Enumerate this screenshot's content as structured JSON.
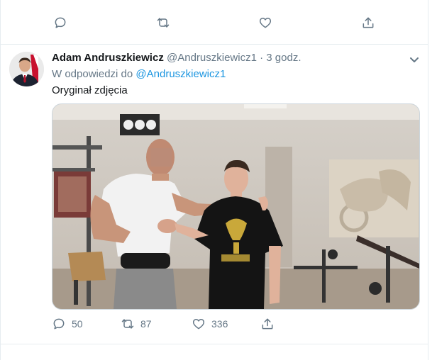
{
  "prev_actions": {
    "reply_icon": "reply-icon",
    "retweet_icon": "retweet-icon",
    "like_icon": "like-icon",
    "share_icon": "share-icon"
  },
  "tweet": {
    "author_name": "Adam Andruszkiewicz",
    "author_handle": "@Andruszkiewicz1",
    "separator": "·",
    "time": "3 godz.",
    "reply_prefix": "W odpowiedzi do",
    "reply_mention": "@Andruszkiewicz1",
    "text": "Oryginał zdjęcia",
    "stats": {
      "replies": "50",
      "retweets": "87",
      "likes": "336"
    }
  },
  "colors": {
    "link": "#1b95e0",
    "muted": "#657786",
    "border": "#e6ecf0"
  }
}
